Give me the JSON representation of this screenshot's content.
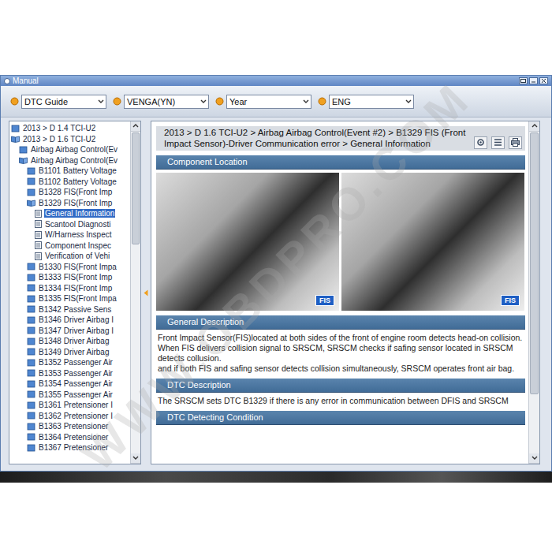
{
  "window": {
    "title": "Manual"
  },
  "toolbar": {
    "dropdowns": [
      {
        "value": "DTC Guide"
      },
      {
        "value": "VENGA(YN)"
      },
      {
        "value": "Year"
      },
      {
        "value": "ENG"
      }
    ]
  },
  "tree": {
    "items": [
      {
        "label": "2013 > D 1.4 TCI-U2",
        "depth": 0,
        "kind": "folder",
        "expanded": false,
        "selected": false
      },
      {
        "label": "2013 > D 1.6 TCI-U2",
        "depth": 0,
        "kind": "folder",
        "expanded": true,
        "selected": false
      },
      {
        "label": "Airbag Airbag Control(Ev",
        "depth": 1,
        "kind": "folder",
        "expanded": false,
        "selected": false
      },
      {
        "label": "Airbag Airbag Control(Ev",
        "depth": 1,
        "kind": "folder",
        "expanded": true,
        "selected": false
      },
      {
        "label": "B1101 Battery Voltage",
        "depth": 2,
        "kind": "folder",
        "expanded": false,
        "selected": false
      },
      {
        "label": "B1102 Battery Voltage",
        "depth": 2,
        "kind": "folder",
        "expanded": false,
        "selected": false
      },
      {
        "label": "B1328 FIS(Front Imp",
        "depth": 2,
        "kind": "folder",
        "expanded": false,
        "selected": false
      },
      {
        "label": "B1329 FIS(Front Imp",
        "depth": 2,
        "kind": "folder",
        "expanded": true,
        "selected": false
      },
      {
        "label": "General Information",
        "depth": 3,
        "kind": "page",
        "expanded": false,
        "selected": true
      },
      {
        "label": "Scantool Diagnosti",
        "depth": 3,
        "kind": "page",
        "expanded": false,
        "selected": false
      },
      {
        "label": "W/Harness Inspect",
        "depth": 3,
        "kind": "page",
        "expanded": false,
        "selected": false
      },
      {
        "label": "Component Inspec",
        "depth": 3,
        "kind": "page",
        "expanded": false,
        "selected": false
      },
      {
        "label": "Verification of Vehi",
        "depth": 3,
        "kind": "page",
        "expanded": false,
        "selected": false
      },
      {
        "label": "B1330 FIS(Front Impa",
        "depth": 2,
        "kind": "folder",
        "expanded": false,
        "selected": false
      },
      {
        "label": "B1333 FIS(Front Imp",
        "depth": 2,
        "kind": "folder",
        "expanded": false,
        "selected": false
      },
      {
        "label": "B1334 FIS(Front Imp",
        "depth": 2,
        "kind": "folder",
        "expanded": false,
        "selected": false
      },
      {
        "label": "B1335 FIS(Front Impa",
        "depth": 2,
        "kind": "folder",
        "expanded": false,
        "selected": false
      },
      {
        "label": "B1342 Passive Sens",
        "depth": 2,
        "kind": "folder",
        "expanded": false,
        "selected": false
      },
      {
        "label": "B1346 Driver Airbag I",
        "depth": 2,
        "kind": "folder",
        "expanded": false,
        "selected": false
      },
      {
        "label": "B1347 Driver Airbag I",
        "depth": 2,
        "kind": "folder",
        "expanded": false,
        "selected": false
      },
      {
        "label": "B1348 Driver Airbag",
        "depth": 2,
        "kind": "folder",
        "expanded": false,
        "selected": false
      },
      {
        "label": "B1349 Driver Airbag",
        "depth": 2,
        "kind": "folder",
        "expanded": false,
        "selected": false
      },
      {
        "label": "B1352 Passenger Air",
        "depth": 2,
        "kind": "folder",
        "expanded": false,
        "selected": false
      },
      {
        "label": "B1353 Passenger Air",
        "depth": 2,
        "kind": "folder",
        "expanded": false,
        "selected": false
      },
      {
        "label": "B1354 Passenger Air",
        "depth": 2,
        "kind": "folder",
        "expanded": false,
        "selected": false
      },
      {
        "label": "B1355 Passenger Air",
        "depth": 2,
        "kind": "folder",
        "expanded": false,
        "selected": false
      },
      {
        "label": "B1361 Pretensioner I",
        "depth": 2,
        "kind": "folder",
        "expanded": false,
        "selected": false
      },
      {
        "label": "B1362 Pretensioner I",
        "depth": 2,
        "kind": "folder",
        "expanded": false,
        "selected": false
      },
      {
        "label": "B1363 Pretensioner",
        "depth": 2,
        "kind": "folder",
        "expanded": false,
        "selected": false
      },
      {
        "label": "B1364 Pretensioner",
        "depth": 2,
        "kind": "folder",
        "expanded": false,
        "selected": false
      },
      {
        "label": "B1367 Pretensioner",
        "depth": 2,
        "kind": "folder",
        "expanded": false,
        "selected": false
      }
    ]
  },
  "content": {
    "breadcrumb": "2013 > D 1.6 TCI-U2 > Airbag Airbag Control(Event #2) > B1329 FIS (Front Impact Sensor)-Driver Communication error > General Information",
    "sections": [
      {
        "title": "Component Location",
        "kind": "photos",
        "photos": [
          {
            "badge": "FIS"
          },
          {
            "badge": "FIS"
          }
        ],
        "paragraphs": []
      },
      {
        "title": "General Description",
        "kind": "text",
        "photos": [],
        "paragraphs": [
          "Front Impact Sensor(FIS)located at both sides of the front of engine room detects head-on collision.",
          "When FIS delivers collision signal to SRSCM, SRSCM checks if safing sensor located in SRSCM detects collusion.",
          "and if both FIS and safing sensor detects collision simultaneously, SRSCM operates front air bag."
        ]
      },
      {
        "title": "DTC Description",
        "kind": "text",
        "photos": [],
        "paragraphs": [
          "The SRSCM sets DTC B1329 if there is any error in communication between DFIS and SRSCM"
        ]
      },
      {
        "title": "DTC Detecting Condition",
        "kind": "text",
        "photos": [],
        "paragraphs": []
      }
    ]
  },
  "watermark": "WWW.OBDPRO.COM"
}
